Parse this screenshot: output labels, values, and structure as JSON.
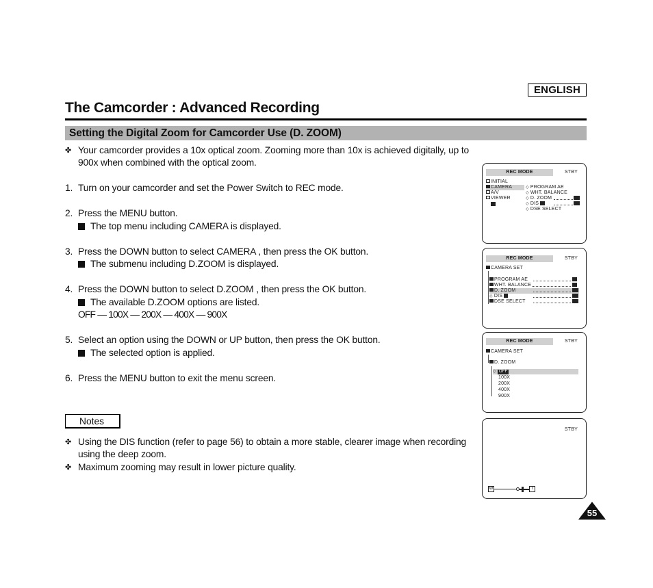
{
  "language_badge": "ENGLISH",
  "page_title": "The Camcorder : Advanced Recording",
  "section_title": "Setting the Digital Zoom for Camcorder Use (D. ZOOM)",
  "intro": {
    "marker": "✤",
    "line1": "Your camcorder provides a 10x optical zoom. Zooming more than 10x is achieved digitally, up to",
    "line2": "900x when combined with the optical zoom."
  },
  "steps": [
    {
      "num": "1.",
      "text": "Turn on your camcorder and set the Power Switch to REC mode."
    },
    {
      "num": "2.",
      "text": "Press the MENU button.",
      "sub": "The top menu including  CAMERA  is displayed."
    },
    {
      "num": "3.",
      "text": "Press the DOWN button to select  CAMERA , then press the OK button.",
      "sub": "The submenu including  D.ZOOM  is displayed."
    },
    {
      "num": "4.",
      "text": "Press the DOWN button to select  D.ZOOM , then press the OK button.",
      "sub": "The available D.ZOOM options are listed.",
      "extra": "OFF — 100X — 200X — 400X — 900X"
    },
    {
      "num": "5.",
      "text": "Select an option using the DOWN or UP button, then press the OK button.",
      "sub": "The selected option is applied."
    },
    {
      "num": "6.",
      "text": "Press the MENU button to exit the menu screen."
    }
  ],
  "notes": {
    "label": "Notes",
    "marker": "✤",
    "items": [
      {
        "line1": "Using the DIS function (refer to page 56) to obtain a more stable, clearer image when recording",
        "line2": "using the deep zoom."
      },
      {
        "line1": "Maximum zooming may result in lower picture quality."
      }
    ]
  },
  "screens": {
    "header": "REC MODE",
    "status": "STBY",
    "screen1": {
      "menu": [
        "INITIAL",
        "CAMERA",
        "A/V",
        "VIEWER"
      ],
      "selected": "CAMERA",
      "submenu": [
        "PROGRAM AE",
        "WHT. BALANCE",
        "D. ZOOM",
        "DIS",
        "DSE SELECT"
      ]
    },
    "screen2": {
      "parent": "CAMERA SET",
      "items": [
        "PROGRAM AE",
        "WHT. BALANCE",
        "D. ZOOM",
        "DIS",
        "DSE SELECT"
      ],
      "selected": "D. ZOOM"
    },
    "screen3": {
      "parent": "CAMERA SET",
      "child": "D. ZOOM",
      "options": [
        "OFF",
        "100X",
        "200X",
        "400X",
        "900X"
      ],
      "selected": "OFF"
    },
    "screen4": {
      "zoom_wide": "W",
      "zoom_tele": "T"
    }
  },
  "page_number": "55"
}
